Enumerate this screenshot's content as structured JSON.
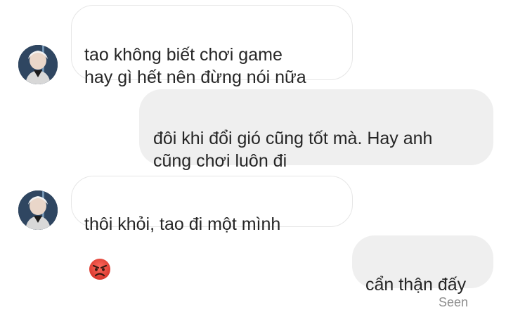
{
  "conversation": {
    "messages": [
      {
        "direction": "incoming",
        "text": "tao không biết chơi game\nhay gì hết nên đừng nói nữa"
      },
      {
        "direction": "outgoing",
        "text": "đôi khi đổi gió cũng tốt mà. Hay anh\ncũng chơi luôn đi"
      },
      {
        "direction": "incoming",
        "text": "thôi khỏi, tao đi một mình",
        "emoji": "angry-face"
      },
      {
        "direction": "outgoing",
        "text": "cẩn thận đấy"
      }
    ],
    "status": "Seen"
  },
  "colors": {
    "incoming_bubble_bg": "#ffffff",
    "incoming_bubble_border": "#e6e6e6",
    "outgoing_bubble_bg": "#efefef",
    "text": "#262626",
    "seen_text": "#8e8e8e",
    "emoji_red": "#e5453b"
  },
  "icons": {
    "avatar": "contact-avatar",
    "reaction": "angry-face-emoji"
  }
}
